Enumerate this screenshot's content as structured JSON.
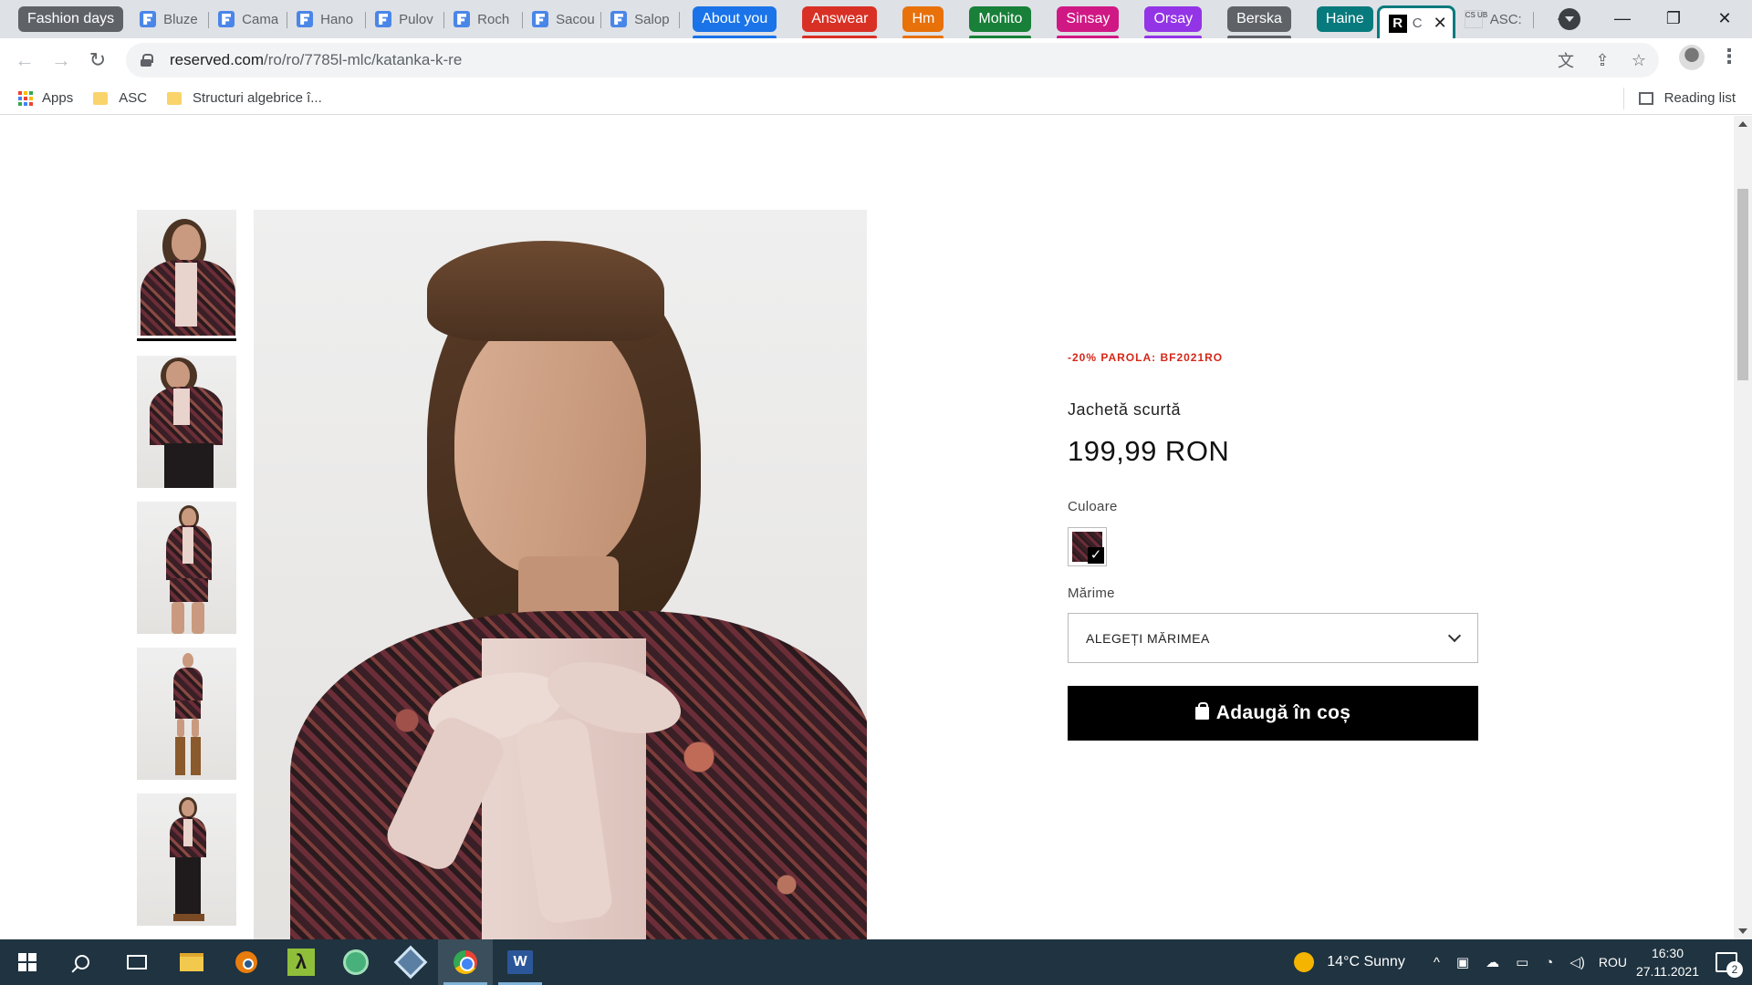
{
  "browser": {
    "tab_groups": [
      {
        "label": "Fashion days",
        "color": "#5f6368"
      },
      {
        "label": "About you",
        "color": "#1a73e8"
      },
      {
        "label": "Answear",
        "color": "#d93025"
      },
      {
        "label": "Hm",
        "color": "#e8710a"
      },
      {
        "label": "Mohito",
        "color": "#188038"
      },
      {
        "label": "Sinsay",
        "color": "#d01884"
      },
      {
        "label": "Orsay",
        "color": "#9334e6"
      },
      {
        "label": "Berska",
        "color": "#5f6368"
      },
      {
        "label": "Haine",
        "color": "#077a7d"
      }
    ],
    "tabs_fd": [
      "Bluze",
      "Cama",
      "Hano",
      "Pulov",
      "Roch",
      "Sacou",
      "Salop"
    ],
    "active_tab": {
      "title": "C",
      "favicon": "R"
    },
    "last_tab": {
      "title": "ASC:",
      "favicon": "CS UB"
    },
    "new_tab_label": "+",
    "window_controls": {
      "minimize": "—",
      "maximize": "❐",
      "close": "✕"
    },
    "url": {
      "host": "reserved.com",
      "path": "/ro/ro/7785l-mlc/katanka-k-re"
    },
    "nav": {
      "back": "←",
      "forward": "→",
      "reload": "↻"
    },
    "bookmarks": [
      {
        "label": "Apps",
        "icon": "apps-grid-icon"
      },
      {
        "label": "ASC",
        "icon": "folder-icon"
      },
      {
        "label": "Structuri algebrice î...",
        "icon": "folder-icon"
      }
    ],
    "reading_list": "Reading list"
  },
  "product": {
    "promo": "-20% PAROLA: BF2021RO",
    "name": "Jachetă scurtă",
    "price": "199,99 RON",
    "color_label": "Culoare",
    "size_label": "Mărime",
    "size_placeholder": "ALEGEȚI MĂRIMEA",
    "add_to_cart": "Adaugă în coș",
    "check_mark": "✓"
  },
  "taskbar": {
    "weather": "14°C  Sunny",
    "language": "ROU",
    "time": "16:30",
    "date": "27.11.2021",
    "notifications": "2",
    "tray_up": "^"
  },
  "colors": {
    "accent_group": "#077a7d",
    "promo_red": "#d62718",
    "taskbar": "#1f3340"
  }
}
